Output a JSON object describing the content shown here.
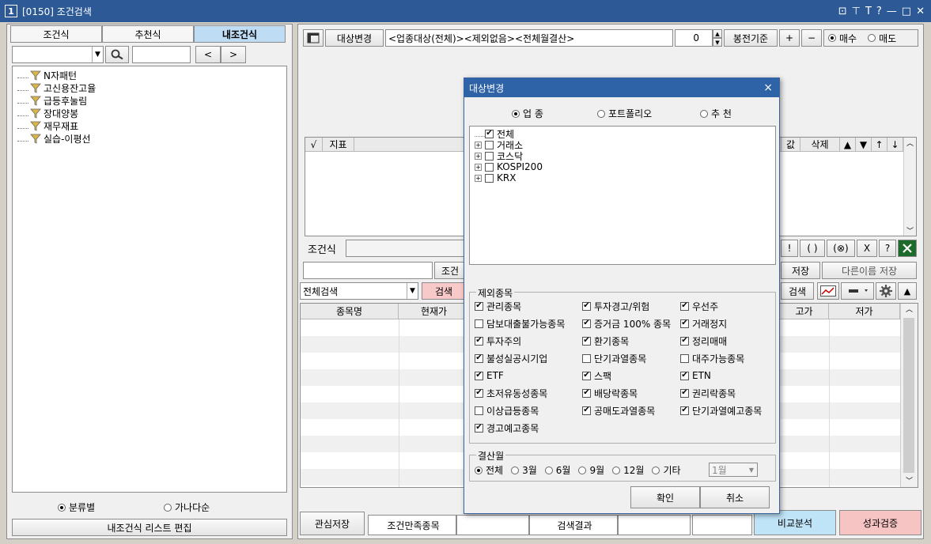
{
  "window": {
    "number": "1",
    "title": "[0150] 조건검색",
    "controls": [
      "⊡",
      "⊤",
      "T",
      "?",
      "—",
      "□",
      "✕"
    ]
  },
  "left": {
    "tabs": [
      "조건식",
      "추천식",
      "내조건식"
    ],
    "active_tab": 2,
    "nav_prev": "<",
    "nav_next": ">",
    "tree": [
      "N자패턴",
      "고신용잔고율",
      "급등후눌림",
      "장대양봉",
      "재무재표",
      "실습-이평선"
    ],
    "radio_category": "분류별",
    "radio_alpha": "가나다순",
    "edit_button": "내조건식 리스트 편집"
  },
  "top": {
    "change_target_button": "대상변경",
    "target_text": "<업종대상(전체)><제외없음><전체월결산>",
    "spinner_value": "0",
    "candle_button": "봉전기준",
    "plus": "+",
    "minus": "−",
    "buy": "매수",
    "sell": "매도"
  },
  "grid": {
    "check_col": "√",
    "indicator_col": "지표",
    "value_col": "값",
    "delete_col": "삭제",
    "arrows": [
      "▲",
      "▼",
      "↑",
      "↓"
    ]
  },
  "condition": {
    "label": "조건식",
    "ops": [
      "!",
      "( )",
      "(⊗)",
      "X",
      "?"
    ],
    "save": "저장",
    "save_as": "다른이름 저장",
    "cond_btn": "조건"
  },
  "search": {
    "scope": "전체검색",
    "search_button": "검색",
    "search_button2": "검색"
  },
  "results": {
    "columns": [
      "종목명",
      "현재가",
      "고가",
      "저가"
    ]
  },
  "bottom": {
    "watch_save": "관심저장",
    "satisfied_tab": "조건만족종목",
    "result_tab": "검색결과",
    "compare": "비교분석",
    "verify": "성과검증"
  },
  "dialog": {
    "title": "대상변경",
    "radios": [
      "업 종",
      "포트폴리오",
      "추 천"
    ],
    "selected_radio": 0,
    "tree": [
      {
        "label": "전체",
        "checked": true,
        "expand": false
      },
      {
        "label": "거래소",
        "checked": false,
        "expand": true
      },
      {
        "label": "코스닥",
        "checked": false,
        "expand": true
      },
      {
        "label": "KOSPI200",
        "checked": false,
        "expand": true
      },
      {
        "label": "KRX",
        "checked": false,
        "expand": true
      }
    ],
    "exclude_label": "제외종목",
    "exclude": [
      {
        "label": "관리종목",
        "checked": true
      },
      {
        "label": "투자경고/위험",
        "checked": true
      },
      {
        "label": "우선주",
        "checked": true
      },
      {
        "label": "담보대출불가능종목",
        "checked": false
      },
      {
        "label": "증거금 100% 종목",
        "checked": true
      },
      {
        "label": "거래정지",
        "checked": true
      },
      {
        "label": "투자주의",
        "checked": true
      },
      {
        "label": "환기종목",
        "checked": true
      },
      {
        "label": "정리매매",
        "checked": true
      },
      {
        "label": "불성실공시기업",
        "checked": true
      },
      {
        "label": "단기과열종목",
        "checked": false
      },
      {
        "label": "대주가능종목",
        "checked": false
      },
      {
        "label": "ETF",
        "checked": true
      },
      {
        "label": "스팩",
        "checked": true
      },
      {
        "label": "ETN",
        "checked": true
      },
      {
        "label": "초저유동성종목",
        "checked": true
      },
      {
        "label": "배당락종목",
        "checked": true
      },
      {
        "label": "권리락종목",
        "checked": true
      },
      {
        "label": "이상급등종목",
        "checked": false
      },
      {
        "label": "공매도과열종목",
        "checked": true
      },
      {
        "label": "단기과열예고종목",
        "checked": true
      },
      {
        "label": "경고예고종목",
        "checked": true
      }
    ],
    "settle_label": "결산월",
    "settle": [
      "전체",
      "3월",
      "6월",
      "9월",
      "12월",
      "기타"
    ],
    "settle_selected": 0,
    "month_select": "1월",
    "ok": "확인",
    "cancel": "취소"
  }
}
